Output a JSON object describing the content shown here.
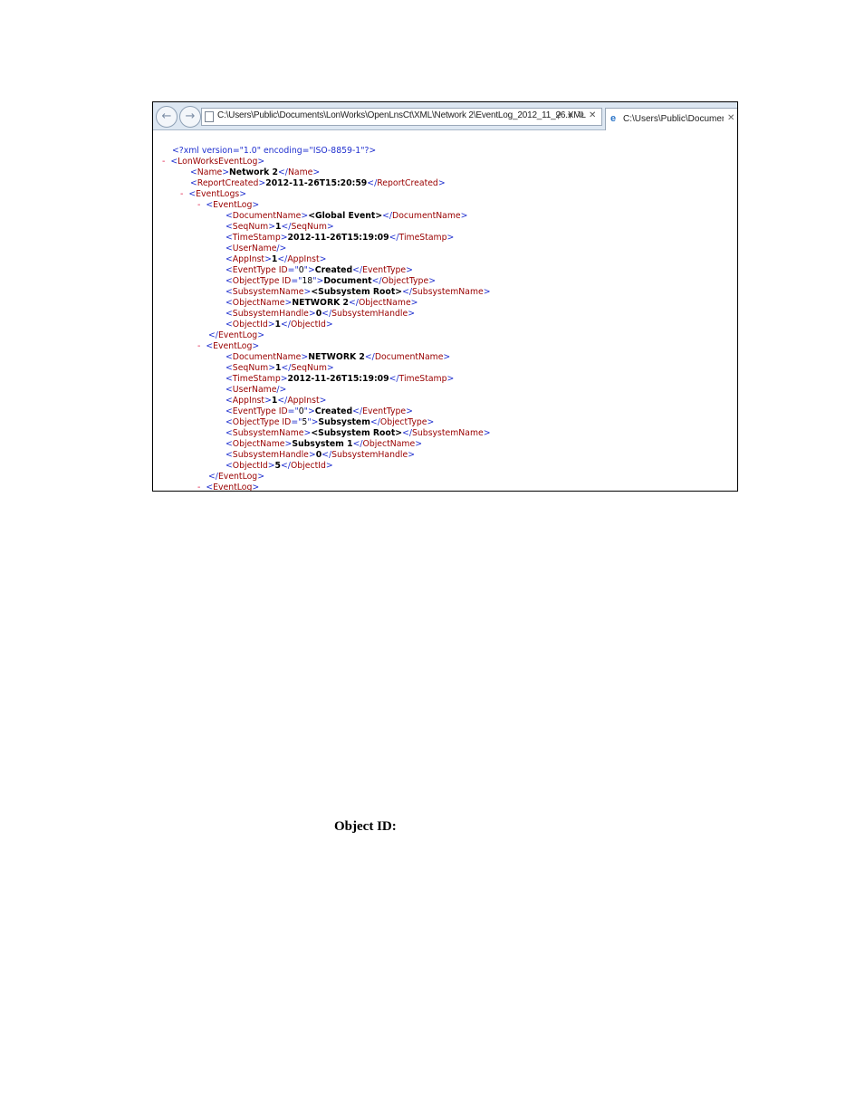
{
  "browser": {
    "address": "C:\\Users\\Public\\Documents\\LonWorks\\OpenLnsCt\\XML\\Network 2\\EventLog_2012_11_26.XML",
    "tab_title": "C:\\Users\\Public\\Document...",
    "icons": {
      "back": "back-arrow-icon",
      "forward": "forward-arrow-icon",
      "search": "search-icon",
      "refresh": "refresh-icon",
      "stop": "close-icon"
    }
  },
  "xml": {
    "declaration": "<?xml version=\"1.0\" encoding=\"ISO-8859-1\"?>",
    "root_tag": "LonWorksEventLog",
    "name": "Network 2",
    "report_created": "2012-11-26T15:20:59",
    "event_logs": [
      {
        "DocumentName": "<Global Event>",
        "SeqNum": "1",
        "TimeStamp": "2012-11-26T15:19:09",
        "AppInst": "1",
        "EventTypeID": "0",
        "EventType": "Created",
        "ObjectTypeID": "18",
        "ObjectType": "Document",
        "SubsystemName": "<Subsystem Root>",
        "ObjectName": "NETWORK 2",
        "SubsystemHandle": "0",
        "ObjectId": "1"
      },
      {
        "DocumentName": "NETWORK 2",
        "SeqNum": "1",
        "TimeStamp": "2012-11-26T15:19:09",
        "AppInst": "1",
        "EventTypeID": "0",
        "EventType": "Created",
        "ObjectTypeID": "5",
        "ObjectType": "Subsystem",
        "SubsystemName": "<Subsystem Root>",
        "ObjectName": "Subsystem 1",
        "SubsystemHandle": "0",
        "ObjectId": "5"
      }
    ]
  },
  "caption": "Object ID:"
}
